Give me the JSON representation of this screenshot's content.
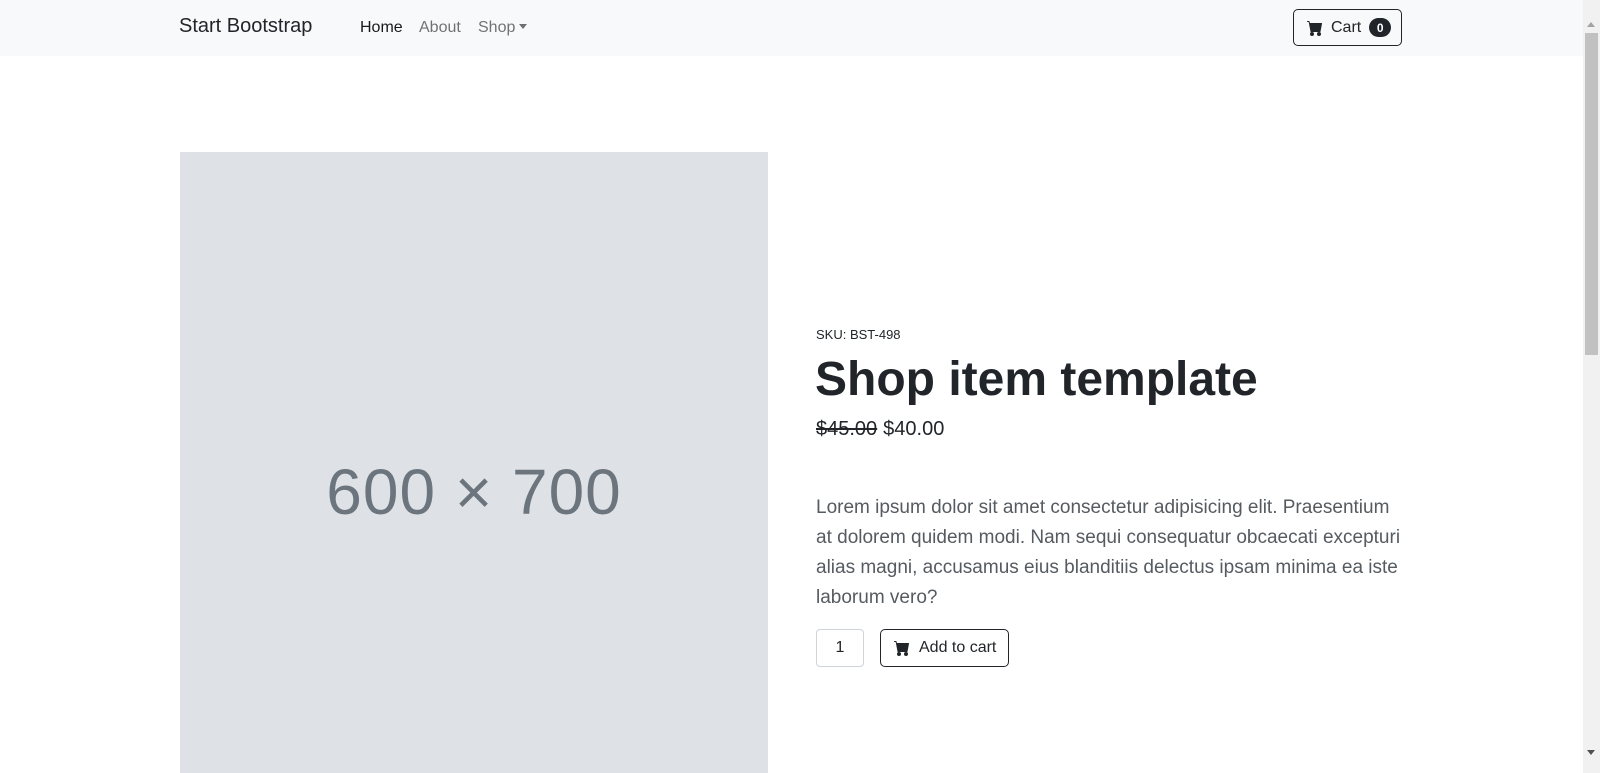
{
  "navbar": {
    "brand": "Start Bootstrap",
    "links": {
      "home": "Home",
      "about": "About",
      "shop": "Shop"
    },
    "cart": {
      "label": "Cart",
      "count": "0",
      "icon": "cart-icon"
    }
  },
  "product": {
    "image_placeholder": "600 × 700",
    "sku": "SKU: BST-498",
    "title": "Shop item template",
    "old_price": "$45.00",
    "price": "$40.00",
    "description": "Lorem ipsum dolor sit amet consectetur adipisicing elit. Praesentium at dolorem quidem modi. Nam sequi consequatur obcaecati excepturi alias magni, accusamus eius blanditiis delectus ipsam minima ea iste laborum vero?",
    "quantity": "1",
    "add_to_cart_label": "Add to cart",
    "add_icon": "cart-icon"
  },
  "colors": {
    "navbar_bg": "#f8f9fa",
    "image_bg": "#dee2e6",
    "text_dark": "#212529",
    "text_muted": "#6c757d"
  }
}
